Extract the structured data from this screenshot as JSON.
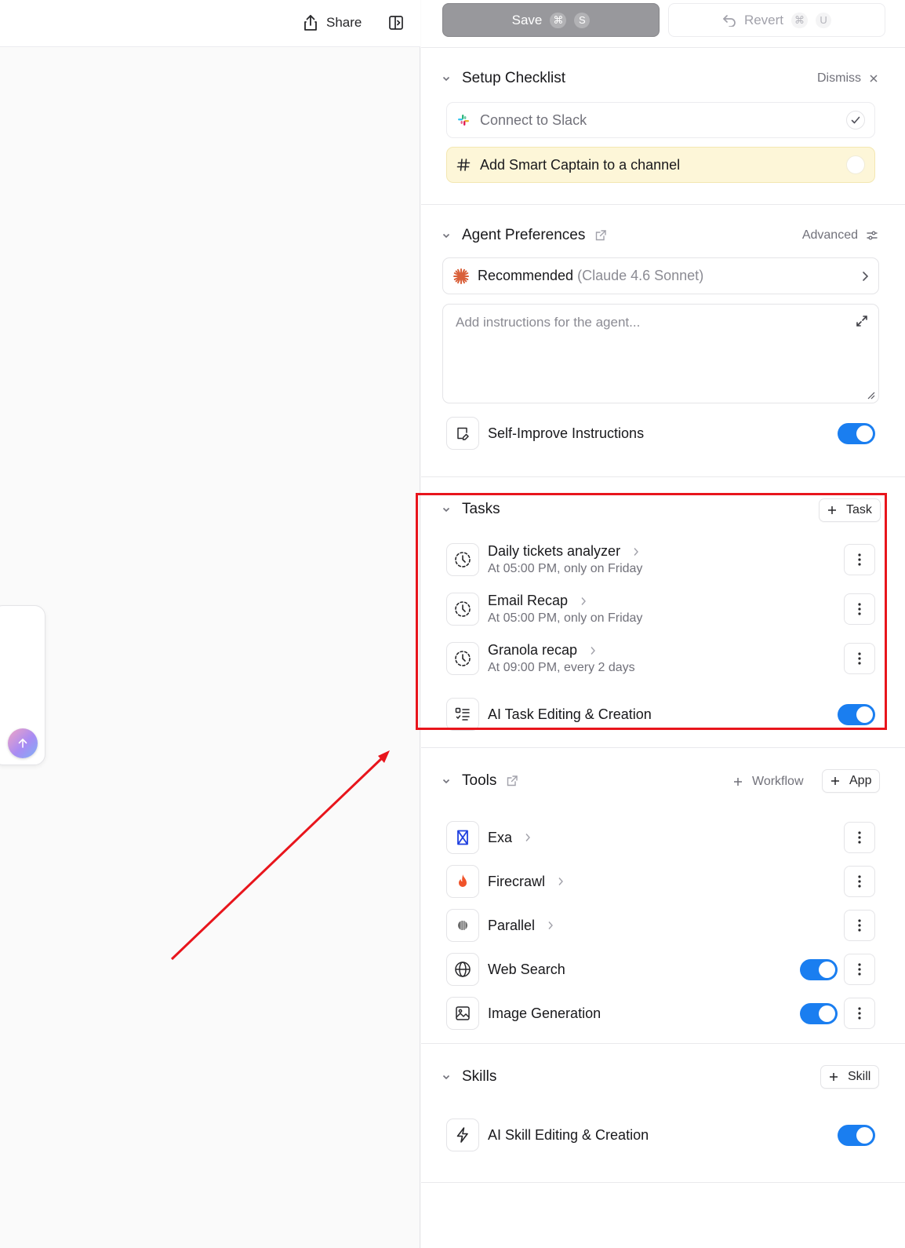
{
  "topbar": {
    "share_label": "Share",
    "save_label": "Save",
    "save_shortcut": [
      "⌘",
      "S"
    ],
    "revert_label": "Revert",
    "revert_shortcut": [
      "⌘",
      "U"
    ]
  },
  "setup_checklist": {
    "title": "Setup Checklist",
    "dismiss_label": "Dismiss",
    "items": [
      {
        "label": "Connect to Slack",
        "done": true,
        "icon": "slack-icon"
      },
      {
        "label": "Add Smart Captain to a channel",
        "done": false,
        "icon": "hash-icon"
      }
    ]
  },
  "agent_preferences": {
    "title": "Agent Preferences",
    "advanced_label": "Advanced",
    "model_label": "Recommended",
    "model_detail": "(Claude 4.6 Sonnet)",
    "instructions_placeholder": "Add instructions for the agent...",
    "self_improve_label": "Self-Improve Instructions",
    "self_improve_on": true
  },
  "tasks": {
    "title": "Tasks",
    "add_label": "Task",
    "items": [
      {
        "title": "Daily tickets analyzer",
        "schedule": "At 05:00 PM, only on Friday"
      },
      {
        "title": "Email Recap",
        "schedule": "At 05:00 PM, only on Friday"
      },
      {
        "title": "Granola recap",
        "schedule": "At 09:00 PM, every 2 days"
      }
    ],
    "ai_editing_label": "AI Task Editing & Creation",
    "ai_editing_on": true
  },
  "tools": {
    "title": "Tools",
    "add_workflow_label": "Workflow",
    "add_app_label": "App",
    "items": [
      {
        "label": "Exa",
        "icon": "exa-icon",
        "has_toggle": false
      },
      {
        "label": "Firecrawl",
        "icon": "flame-icon",
        "has_toggle": false
      },
      {
        "label": "Parallel",
        "icon": "parallel-icon",
        "has_toggle": false
      },
      {
        "label": "Web Search",
        "icon": "globe-icon",
        "has_toggle": true,
        "on": true
      },
      {
        "label": "Image Generation",
        "icon": "image-icon",
        "has_toggle": true,
        "on": true
      }
    ]
  },
  "skills": {
    "title": "Skills",
    "add_label": "Skill",
    "ai_editing_label": "AI Skill Editing & Creation",
    "ai_editing_on": true
  },
  "colors": {
    "accent": "#1a7ef0",
    "highlight_row": "#fdf6d8",
    "annotation": "#e8151c",
    "save_button": "#98989c"
  }
}
